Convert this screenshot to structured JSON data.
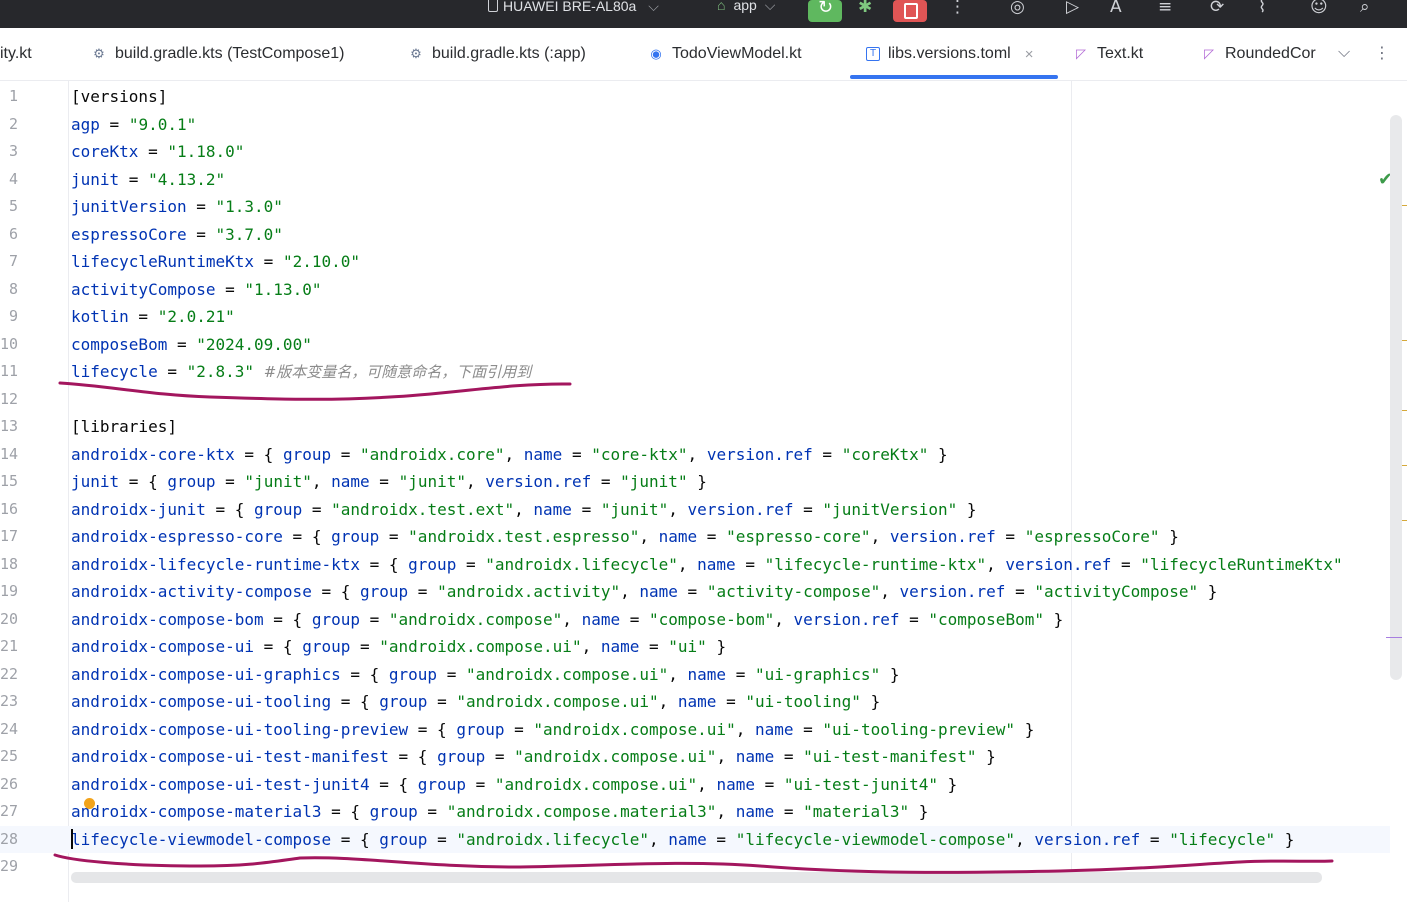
{
  "toolbar": {
    "device": "HUAWEI BRE-AL80a",
    "config": "app",
    "colors": {
      "rerun": "#5fb85f",
      "stop": "#e05555"
    }
  },
  "tabs": [
    {
      "label": "ity.kt"
    },
    {
      "label": "build.gradle.kts (TestCompose1)"
    },
    {
      "label": "build.gradle.kts (:app)"
    },
    {
      "label": "TodoViewModel.kt"
    },
    {
      "label": "libs.versions.toml",
      "active": true
    },
    {
      "label": "Text.kt"
    },
    {
      "label": "RoundedCor"
    }
  ],
  "lines": [
    {
      "n": "1",
      "code": "[versions]"
    },
    {
      "n": "2",
      "code": "agp = \"9.0.1\""
    },
    {
      "n": "3",
      "code": "coreKtx = \"1.18.0\""
    },
    {
      "n": "4",
      "code": "junit = \"4.13.2\""
    },
    {
      "n": "5",
      "code": "junitVersion = \"1.3.0\""
    },
    {
      "n": "6",
      "code": "espressoCore = \"3.7.0\""
    },
    {
      "n": "7",
      "code": "lifecycleRuntimeKtx = \"2.10.0\""
    },
    {
      "n": "8",
      "code": "activityCompose = \"1.13.0\""
    },
    {
      "n": "9",
      "code": "kotlin = \"2.0.21\""
    },
    {
      "n": "10",
      "code": "composeBom = \"2024.09.00\""
    },
    {
      "n": "11",
      "code": "lifecycle = \"2.8.3\" #版本变量名，可随意命名，下面引用到"
    },
    {
      "n": "12",
      "code": ""
    },
    {
      "n": "13",
      "code": "[libraries]"
    },
    {
      "n": "14",
      "code": "androidx-core-ktx = { group = \"androidx.core\", name = \"core-ktx\", version.ref = \"coreKtx\" }"
    },
    {
      "n": "15",
      "code": "junit = { group = \"junit\", name = \"junit\", version.ref = \"junit\" }"
    },
    {
      "n": "16",
      "code": "androidx-junit = { group = \"androidx.test.ext\", name = \"junit\", version.ref = \"junitVersion\" }"
    },
    {
      "n": "17",
      "code": "androidx-espresso-core = { group = \"androidx.test.espresso\", name = \"espresso-core\", version.ref = \"espressoCore\" }"
    },
    {
      "n": "18",
      "code": "androidx-lifecycle-runtime-ktx = { group = \"androidx.lifecycle\", name = \"lifecycle-runtime-ktx\", version.ref = \"lifecycleRuntimeKtx\""
    },
    {
      "n": "19",
      "code": "androidx-activity-compose = { group = \"androidx.activity\", name = \"activity-compose\", version.ref = \"activityCompose\" }"
    },
    {
      "n": "20",
      "code": "androidx-compose-bom = { group = \"androidx.compose\", name = \"compose-bom\", version.ref = \"composeBom\" }"
    },
    {
      "n": "21",
      "code": "androidx-compose-ui = { group = \"androidx.compose.ui\", name = \"ui\" }"
    },
    {
      "n": "22",
      "code": "androidx-compose-ui-graphics = { group = \"androidx.compose.ui\", name = \"ui-graphics\" }"
    },
    {
      "n": "23",
      "code": "androidx-compose-ui-tooling = { group = \"androidx.compose.ui\", name = \"ui-tooling\" }"
    },
    {
      "n": "24",
      "code": "androidx-compose-ui-tooling-preview = { group = \"androidx.compose.ui\", name = \"ui-tooling-preview\" }"
    },
    {
      "n": "25",
      "code": "androidx-compose-ui-test-manifest = { group = \"androidx.compose.ui\", name = \"ui-test-manifest\" }"
    },
    {
      "n": "26",
      "code": "androidx-compose-ui-test-junit4 = { group = \"androidx.compose.ui\", name = \"ui-test-junit4\" }"
    },
    {
      "n": "27",
      "code": "androidx-compose-material3 = { group = \"androidx.compose.material3\", name = \"material3\" }"
    },
    {
      "n": "28",
      "code": "lifecycle-viewmodel-compose = { group = \"androidx.lifecycle\", name = \"lifecycle-viewmodel-compose\", version.ref = \"lifecycle\" }",
      "current": true
    },
    {
      "n": "29",
      "code": ""
    }
  ],
  "annotation_color": "#a3165e"
}
